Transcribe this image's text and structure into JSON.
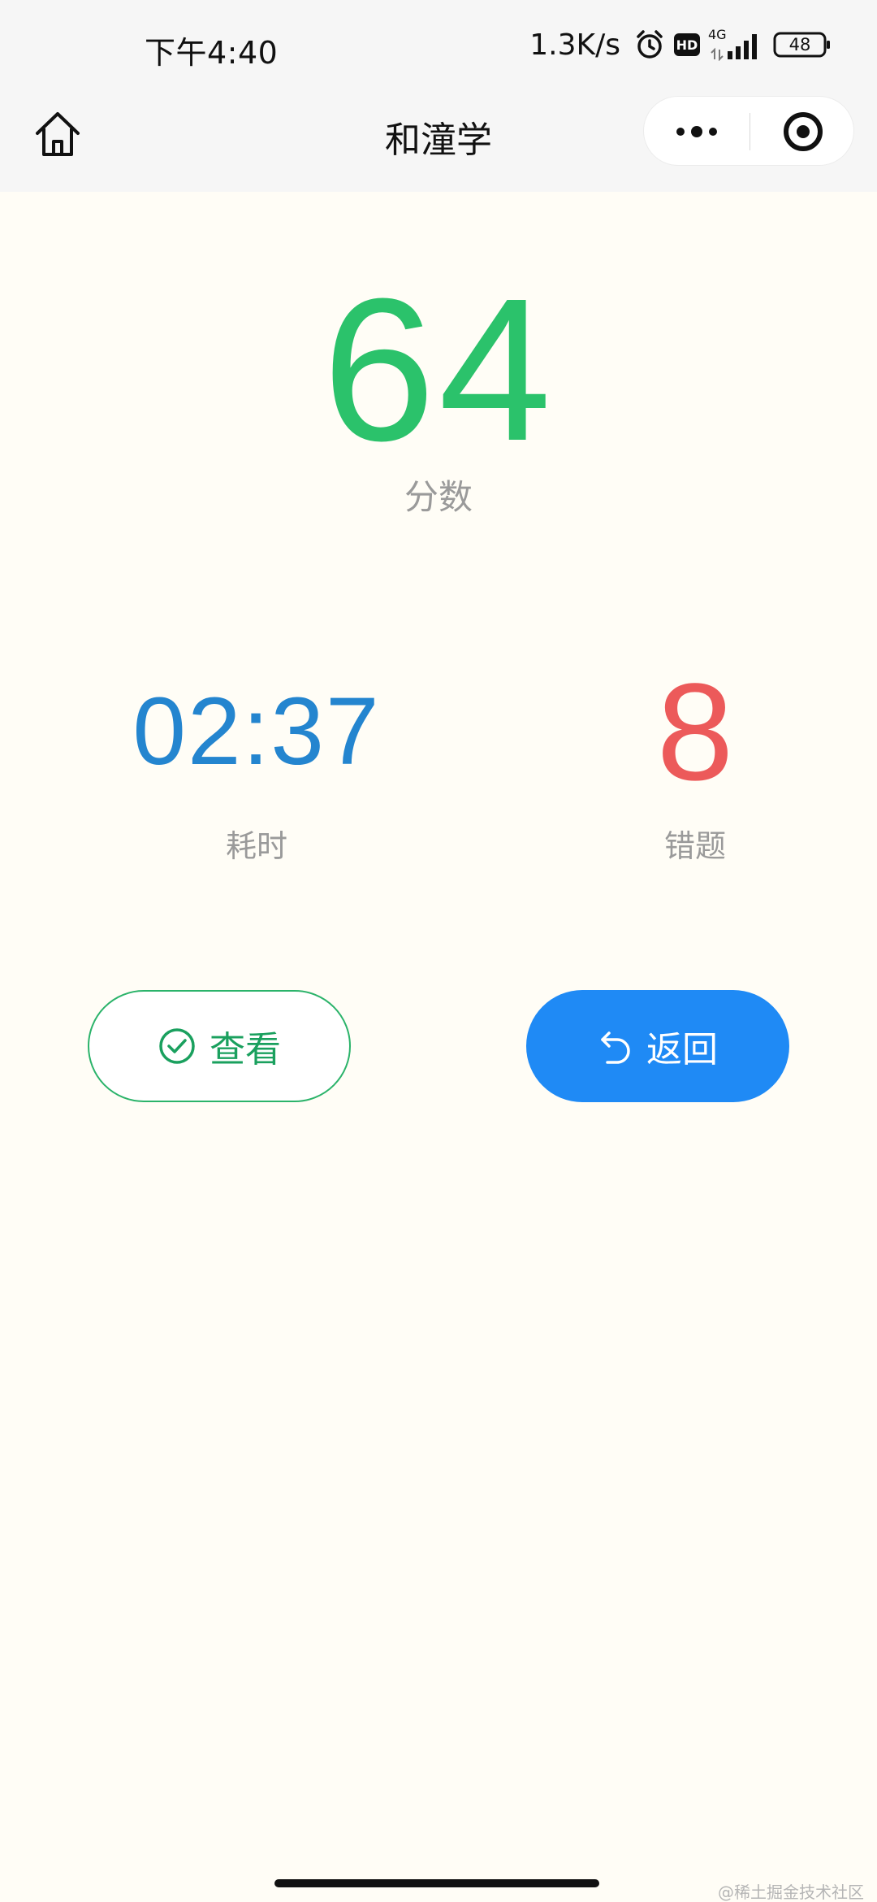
{
  "status_bar": {
    "time": "下午4:40",
    "net_speed": "1.3K/s",
    "hd_label": "HD",
    "network": "4G",
    "battery": "48"
  },
  "header": {
    "title": "和潼学"
  },
  "score": {
    "value": "64",
    "label": "分数"
  },
  "stats": {
    "time_value": "02:37",
    "time_label": "耗时",
    "wrong_value": "8",
    "wrong_label": "错题"
  },
  "actions": {
    "view_label": "查看",
    "back_label": "返回"
  },
  "watermark": "@稀土掘金技术社区",
  "colors": {
    "score": "#2bc26b",
    "time": "#2485cf",
    "wrong": "#ec5a5a",
    "view_border": "#2bb36a",
    "back_bg": "#1f8af5",
    "background": "#fffdf6"
  },
  "icons": {
    "home": "home-icon",
    "more": "more-dots-icon",
    "close": "target-icon",
    "view": "check-circle-icon",
    "back": "undo-arrow-icon"
  }
}
